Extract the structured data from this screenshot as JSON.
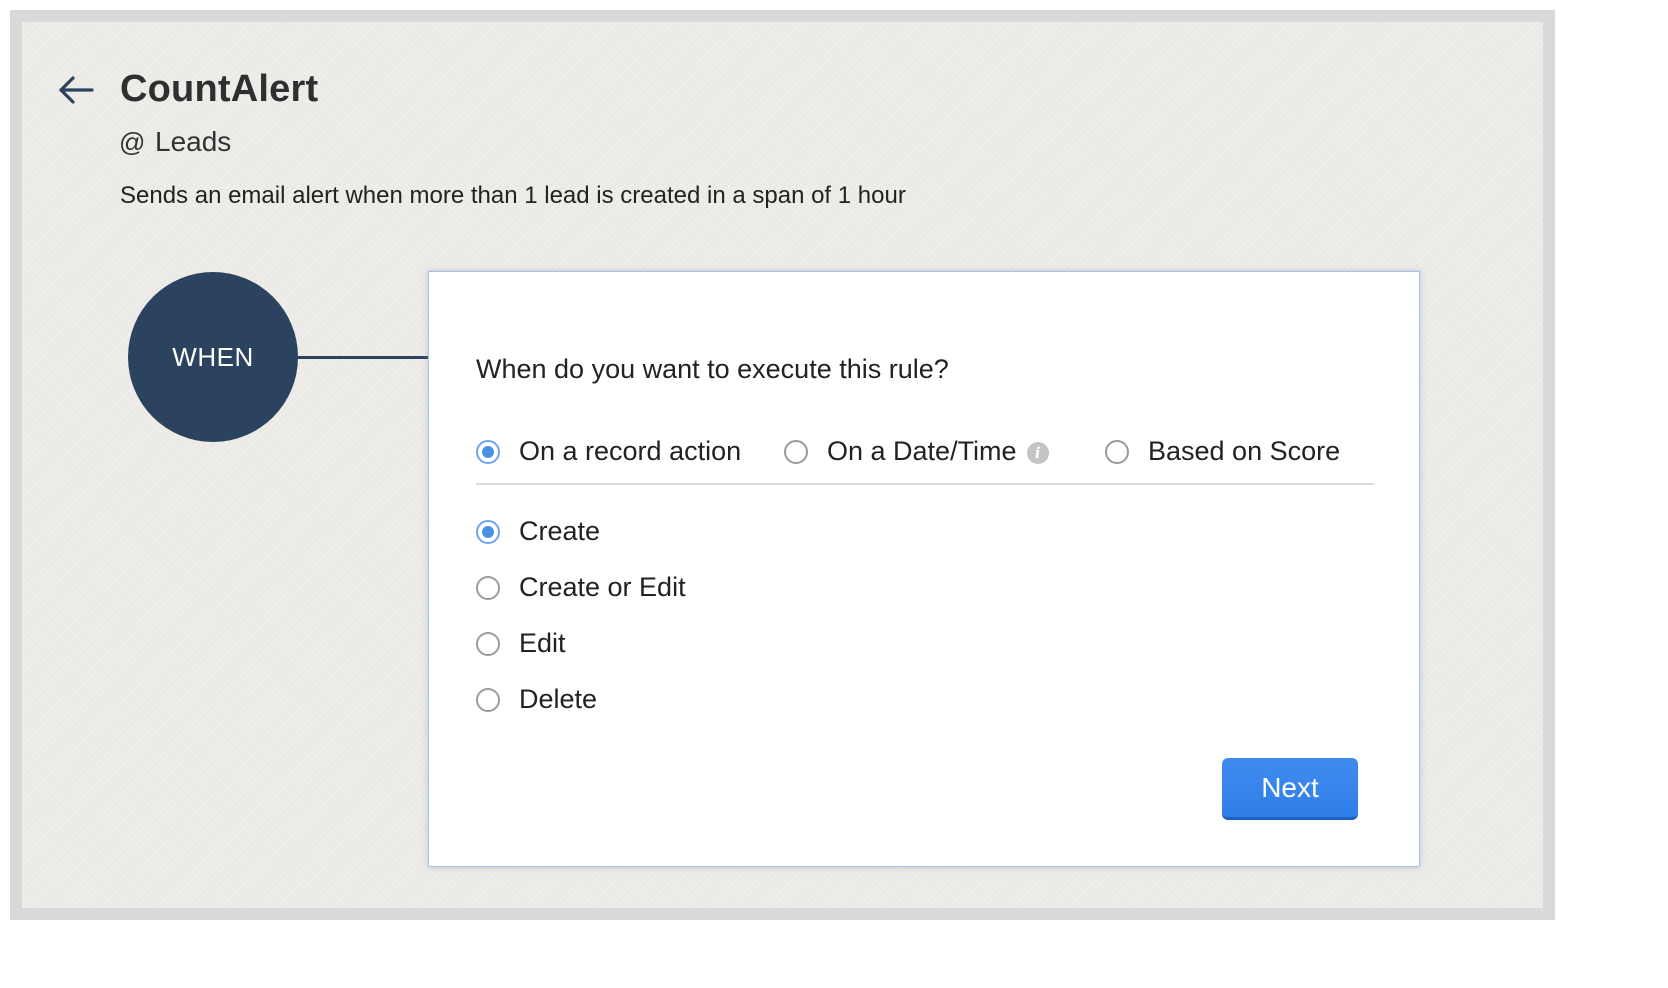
{
  "header": {
    "title": "CountAlert",
    "module_prefix": "@",
    "module": "Leads",
    "description": "Sends an email alert when more than 1 lead is created in a span of 1 hour"
  },
  "flow": {
    "when_label": "WHEN"
  },
  "card": {
    "question": "When do you want to execute this rule?",
    "trigger_types": [
      {
        "label": "On a record action",
        "selected": true
      },
      {
        "label": "On a Date/Time",
        "selected": false,
        "icon": "info-icon"
      },
      {
        "label": "Based on Score",
        "selected": false
      }
    ],
    "actions": [
      {
        "label": "Create",
        "selected": true
      },
      {
        "label": "Create or Edit",
        "selected": false
      },
      {
        "label": "Edit",
        "selected": false
      },
      {
        "label": "Delete",
        "selected": false
      }
    ],
    "next_label": "Next"
  },
  "colors": {
    "accent_blue": "#3a88ee",
    "when_circle": "#2c4360",
    "background": "#ecebe7"
  },
  "icons": {
    "back": "back-arrow-icon",
    "info": "info-icon"
  }
}
